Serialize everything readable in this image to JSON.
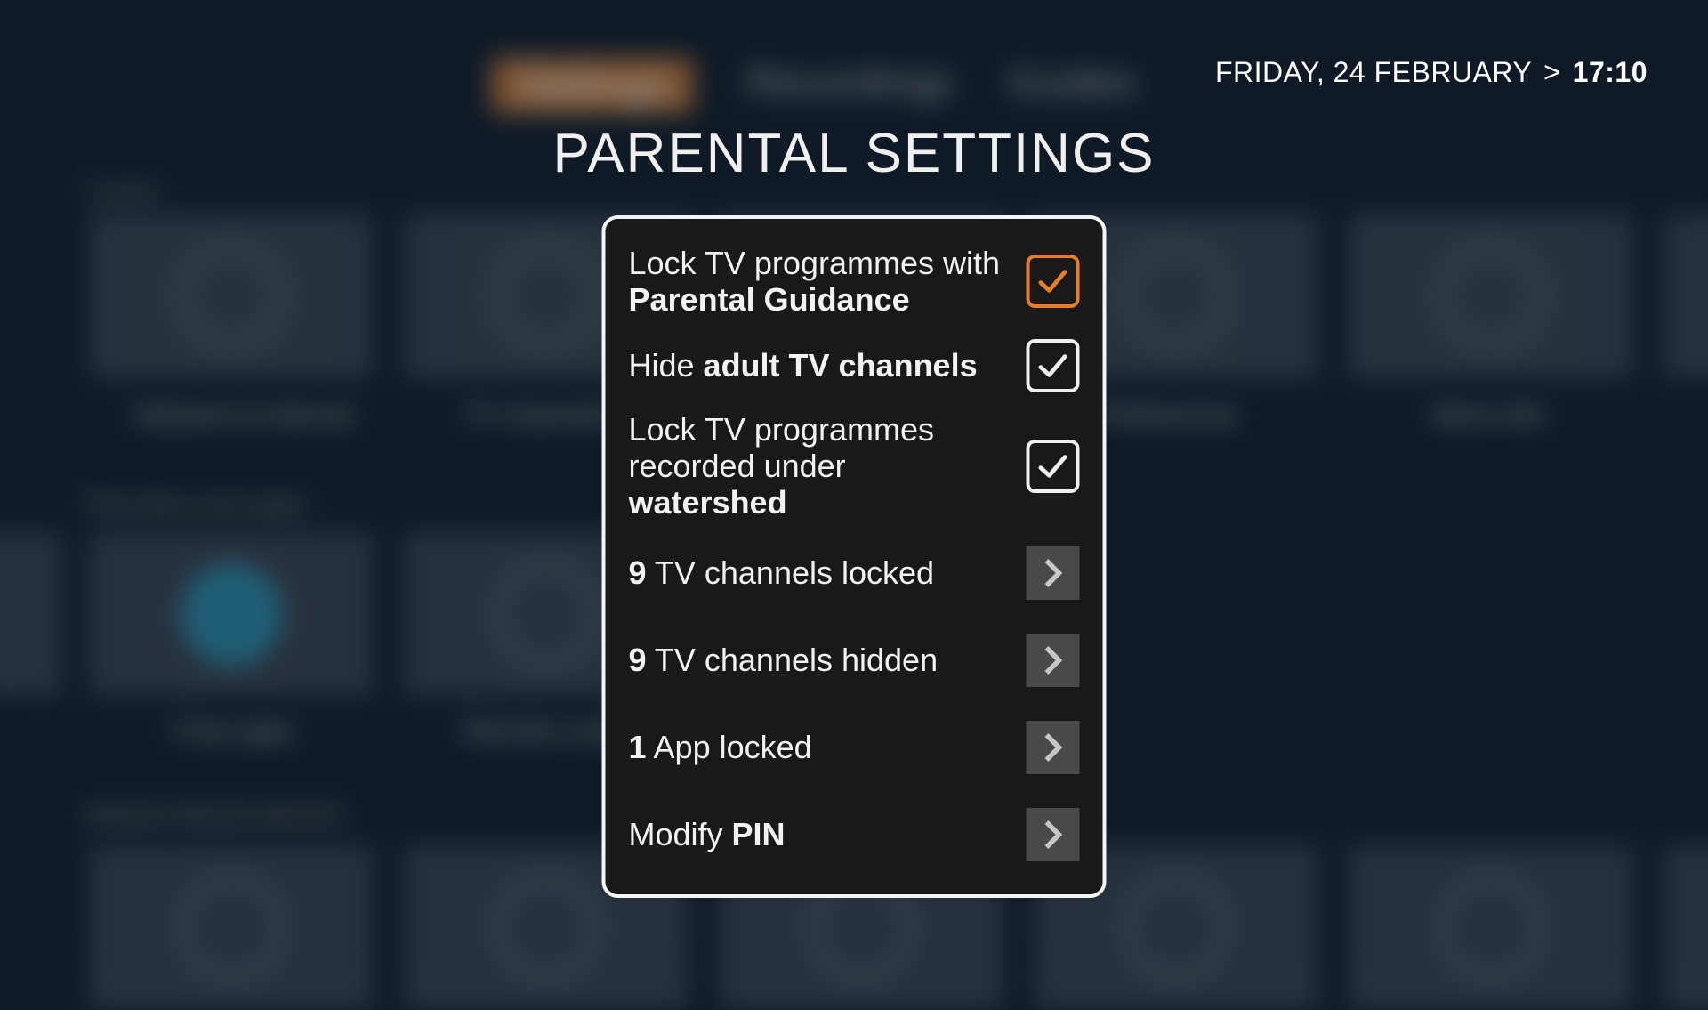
{
  "datetime": {
    "date": "FRIDAY, 24 FEBRUARY",
    "separator": ">",
    "time": "17:10"
  },
  "title": "PARENTAL SETTINGS",
  "background_nav": {
    "items": [
      "Settings",
      "Recordings",
      "Guides"
    ]
  },
  "options": {
    "pg_lock": {
      "prefix": "Lock TV programmes with ",
      "bold": "Parental Guidance",
      "checked": true,
      "highlighted": true
    },
    "hide_adult": {
      "prefix": "Hide ",
      "bold": "adult TV channels",
      "checked": true,
      "highlighted": false
    },
    "watershed": {
      "prefix": "Lock TV programmes recorded under ",
      "bold": "watershed",
      "checked": true,
      "highlighted": false
    }
  },
  "links": {
    "channels_locked": {
      "count": "9",
      "suffix": " TV channels locked"
    },
    "channels_hidden": {
      "count": "9",
      "suffix": " TV channels hidden"
    },
    "app_locked": {
      "count": "1",
      "suffix": " App locked"
    },
    "modify_pin": {
      "prefix": "Modify ",
      "bold": "PIN"
    }
  }
}
